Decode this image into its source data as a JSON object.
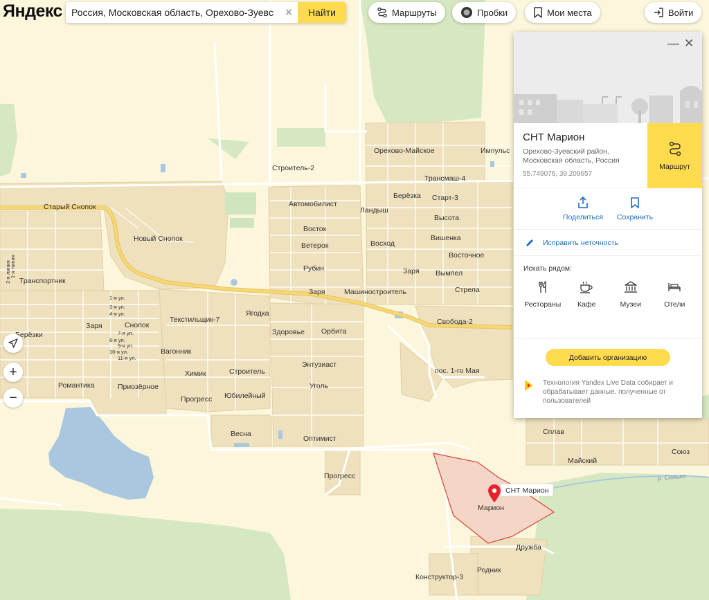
{
  "header": {
    "logo_text": "Яндекс",
    "search_value": "Россия, Московская область, Орехово-Зуевский район",
    "search_button": "Найти",
    "routes_label": "Маршруты",
    "traffic_label": "Пробки",
    "places_label": "Мои места",
    "login_label": "Войти"
  },
  "map_labels": {
    "stary_snopok": "Старый Снопок",
    "novy_snopok": "Новый Снопок",
    "transportnik": "Транспортник",
    "berezki": "Берёзки",
    "zarya_left": "Заря",
    "snopok": "Снопок",
    "line1": "1-я ул.",
    "line3": "3-я ул.",
    "line4": "4-я ул.",
    "line7": "7-я ул.",
    "line8": "8-я ул.",
    "line9": "9-я ул.",
    "line10": "10-я ул.",
    "line11": "11-я ул.",
    "line_v1": "2-я линия",
    "line_v2": "1-я линия",
    "romantika": "Романтика",
    "priozernoe": "Приозёрное",
    "vagonnik": "Вагонник",
    "tekstilshchik": "Текстильщик-7",
    "yagodka": "Ягодка",
    "khimik": "Химик",
    "progress_left": "Прогресс",
    "stroitel": "Строитель",
    "yubileyny": "Юбилейный",
    "vesna": "Весна",
    "zdorovye": "Здоровье",
    "orbita": "Орбита",
    "entuziast": "Энтузиаст",
    "ugol": "Уголь",
    "optimist": "Оптимист",
    "progress_mid": "Прогресс",
    "stroitel2": "Строитель-2",
    "orekhovo_mayskoe": "Орехово-Майское",
    "impuls": "Импульс",
    "transmash": "Трансмаш-4",
    "avtomobilist": "Автомобилист",
    "landysh": "Ландыш",
    "beryozka": "Берёзка",
    "start3": "Старт-3",
    "vostok": "Восток",
    "veterok": "Ветерок",
    "voskhod": "Восход",
    "vysota": "Высота",
    "vishenka": "Вишенка",
    "vostochnoe": "Восточное",
    "rubin": "Рубин",
    "zarya_mid": "Заря",
    "vympel": "Вымпел",
    "strela": "Стрела",
    "zarya_bot": "Заря",
    "mashinostroitel": "Машиностроитель",
    "svoboda": "Свобода-2",
    "pos_1maya": "пос. 1-го Мая",
    "splav": "Сплав",
    "mayskiy": "Майский",
    "soyuz": "Союз",
    "river": "р. Сеньго",
    "marion_pin": "СНТ Марион",
    "marion": "Марион",
    "druzhba": "Дружба",
    "rodnik": "Родник",
    "konstruktor": "Конструктор-3"
  },
  "card": {
    "title": "СНТ Марион",
    "address": "Орехово-Зуевский район, Московская область, Россия",
    "coords": "55.749076, 39.209657",
    "route_label": "Маршрут",
    "share_label": "Поделиться",
    "save_label": "Сохранить",
    "fix_label": "Исправить неточность",
    "nearby_title": "Искать рядом:",
    "nearby": [
      "Рестораны",
      "Кафе",
      "Музеи",
      "Отели"
    ],
    "add_org_label": "Добавить организацию",
    "tech_text": "Технология Yandex Live Data собирает и обрабатывает данные, полученные от пользователей"
  },
  "colors": {
    "map_bg": "#fbf6dc",
    "settlement": "#efe1bd",
    "forest": "#d6e8c1",
    "water": "#a9c8e0",
    "road_major": "#f6d775",
    "selection": "#f4d6c6",
    "accent_yellow": "#ffdb4d",
    "link_blue": "#1a6cc6",
    "pin_red": "#e5232c"
  }
}
